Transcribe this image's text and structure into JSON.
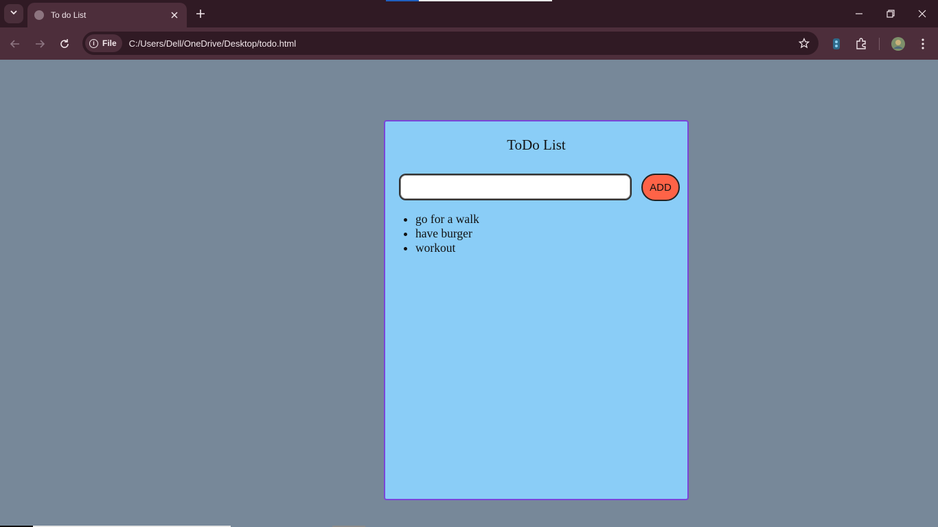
{
  "browser": {
    "tab_title": "To do List",
    "site_chip_label": "File",
    "url": "C:/Users/Dell/OneDrive/Desktop/todo.html",
    "icons": {
      "tab_search": "chevron-down-icon",
      "favicon": "globe-icon",
      "tab_close": "close-icon",
      "new_tab": "plus-icon",
      "back": "arrow-left-icon",
      "forward": "arrow-right-icon",
      "reload": "reload-icon",
      "info": "info-icon",
      "bookmark": "star-icon",
      "extension_app": "extension-app-icon",
      "extensions": "puzzle-icon",
      "profile": "avatar-icon",
      "menu": "kebab-menu-icon",
      "minimize": "minimize-icon",
      "restore": "restore-icon",
      "close_window": "close-icon"
    }
  },
  "app": {
    "title": "ToDo List",
    "input": {
      "value": "",
      "placeholder": ""
    },
    "add_button_label": "ADD",
    "items": [
      "go for a walk",
      "have burger",
      "workout"
    ]
  },
  "colors": {
    "page_background": "#778899",
    "card_background": "#8acdf7",
    "card_border": "#7b45d8",
    "add_button": "#fe6347",
    "chrome_dark": "#301a24",
    "chrome_mid": "#4d2e3b"
  }
}
